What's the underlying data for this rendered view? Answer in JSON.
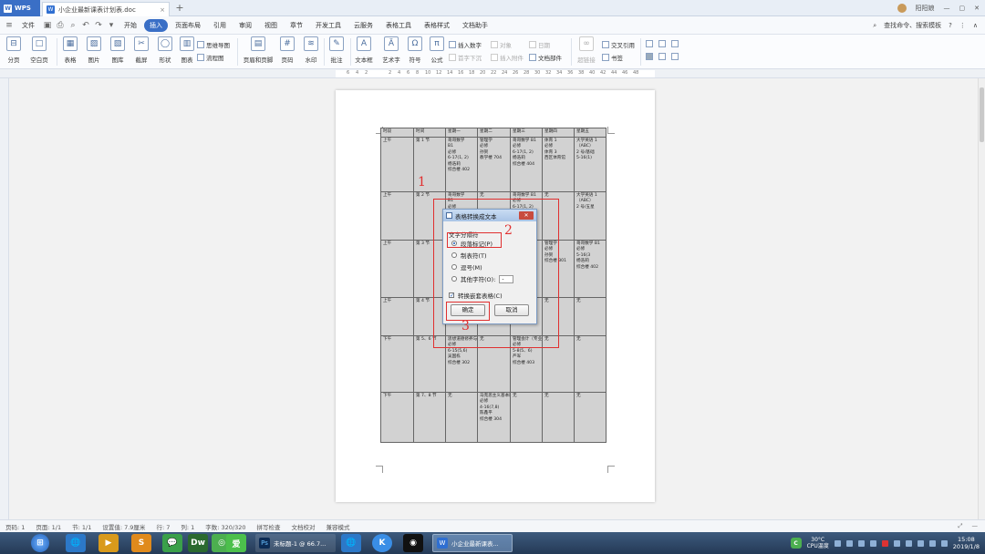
{
  "titlebar": {
    "app": "WPS",
    "doc_title": "小企业最新课表计划表.doc",
    "user": "阳阳娘"
  },
  "menu": {
    "file": "文件",
    "tabs": [
      "开始",
      "插入",
      "页面布局",
      "引用",
      "审阅",
      "视图",
      "章节",
      "开发工具",
      "云服务",
      "表格工具",
      "表格样式",
      "文档助手"
    ],
    "active": "插入",
    "search": "查找命令、搜索模板"
  },
  "ribbon": {
    "page_break": "分页",
    "blank_page": "空白页",
    "table": "表格",
    "picture": "图片",
    "gallery": "图库",
    "screenshot": "截屏",
    "shape": "形状",
    "chart": "图表",
    "mindmap": "思维导图",
    "flowchart": "流程图",
    "header_footer": "页眉和页脚",
    "page_number": "页码",
    "watermark": "水印",
    "comment": "批注",
    "textbox": "文本框",
    "wordart": "艺术字",
    "symbol": "符号",
    "formula": "公式",
    "insert_number": "插入数字",
    "object": "对象",
    "date": "日期",
    "first_drop": "首字下沉",
    "insert_attachment": "插入附件",
    "doc_parts": "文档部件",
    "hyperlink": "超链接",
    "crossref": "交叉引用",
    "bookmark": "书签"
  },
  "ruler": {
    "labels": [
      "6",
      "4",
      "2",
      "2",
      "4",
      "6",
      "8",
      "10",
      "12",
      "14",
      "16",
      "18",
      "20",
      "22",
      "24",
      "26",
      "28",
      "30",
      "32",
      "34",
      "36",
      "38",
      "40",
      "42",
      "44",
      "46",
      "48"
    ]
  },
  "table": {
    "headers": [
      "时段",
      "时间",
      "星期一",
      "星期二",
      "星期三",
      "星期四",
      "星期五"
    ],
    "rows": [
      {
        "period": "上午",
        "time": "第 1 节",
        "mon": [
          "哥哥数学",
          "B1",
          "必修",
          "6-17(1, 2)",
          "杨浩莉",
          "综合楼 402"
        ],
        "tue": [
          "管理学",
          "必修",
          "孙贺",
          "教学楼 704"
        ],
        "wed": [
          "哥哥数学 B1",
          "必修",
          "6-17(1, 2)",
          "杨浩莉",
          "综合楼 404"
        ],
        "thu": [
          "体育 1",
          "必修",
          "体育 3",
          "西区体育馆"
        ],
        "fri": [
          "大学英语 1",
          "（ABC）",
          "2 号/基础",
          "5-16(1)"
        ]
      },
      {
        "period": "上午",
        "time": "第 2 节",
        "mon": [
          "哥哥数学",
          "B1",
          "必修"
        ],
        "tue": [
          "无"
        ],
        "wed": [
          "哥哥数学 B1",
          "必修",
          "6-17(1, 2)"
        ],
        "thu": [
          "无"
        ],
        "fri": [
          "大学英语 1",
          "（ABC）",
          "2 号/五星"
        ]
      },
      {
        "period": "上午",
        "time": "第 3 节",
        "mon": [],
        "tue": [],
        "wed": [],
        "thu": [
          "管理学",
          "必修",
          "孙贺",
          "综合楼 301"
        ],
        "fri": [
          "哥哥数学 B1",
          "必修",
          "5-16(3",
          "杨浩莉",
          "综合楼 402"
        ]
      },
      {
        "period": "上午",
        "time": "第 4 节",
        "mon": [],
        "tue": [],
        "wed": [],
        "thu": [
          "无"
        ],
        "fri": [
          "无"
        ]
      },
      {
        "period": "下午",
        "time": "第 5、6 节",
        "mon": [
          "思想道德修养与法律基础 1",
          "必修",
          "6-15(5,6)",
          "吴国栋",
          "综合楼 302"
        ],
        "tue": [
          "无"
        ],
        "wed": [
          "管理会计（专业）理论",
          "必修",
          "5-8(5、6)",
          "严军",
          "综合楼 403"
        ],
        "thu": [
          "无"
        ],
        "fri": [
          "无"
        ]
      },
      {
        "period": "下午",
        "time": "第 7、8 节",
        "mon": [
          "无"
        ],
        "tue": [
          "马克思主义基本原理",
          "必修",
          "4-16(7,8)",
          "陈鑫平",
          "综合楼 304"
        ],
        "wed": [
          "无"
        ],
        "thu": [
          "无"
        ],
        "fri": [
          "无"
        ]
      }
    ]
  },
  "dialog": {
    "title": "表格转换成文本",
    "group": "文字分隔符",
    "options": [
      "段落标记(P)",
      "制表符(T)",
      "逗号(M)",
      "其他字符(O):"
    ],
    "other_value": "-",
    "nested": "转换嵌套表格(C)",
    "ok": "确定",
    "cancel": "取消",
    "close": "✕"
  },
  "annotations": [
    "1",
    "2",
    "3"
  ],
  "status": {
    "page_num": "页码: 1",
    "pages": "页面: 1/1",
    "section": "节: 1/1",
    "position": "设置值: 7.9厘米",
    "line": "行: 7",
    "column": "列: 1",
    "words": "字数: 320/320",
    "spell": "拼写检查",
    "proof": "文档校对",
    "compat": "兼容模式"
  },
  "taskbar": {
    "apps": [
      "🌐",
      "▶",
      "S",
      "💬",
      "Dw",
      "◎",
      "爱"
    ],
    "ps_task": "未标题-1 @ 66.7...",
    "wps_task": "小企业最新课表...",
    "temp": "30°C",
    "cpu": "CPU温度",
    "time": "15:08",
    "date": "2019/1/8"
  }
}
